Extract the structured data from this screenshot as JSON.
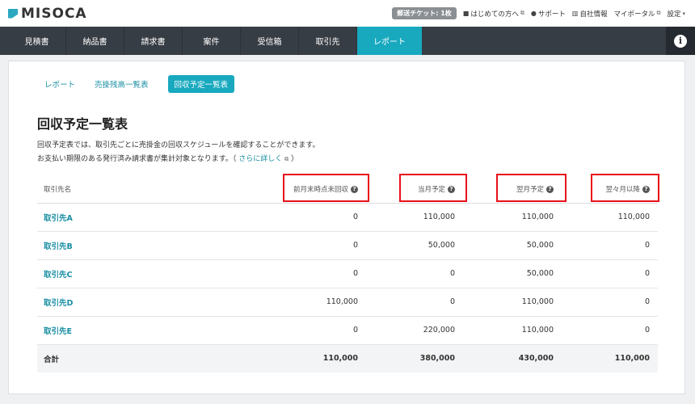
{
  "app": {
    "logo_text": "MISOCA"
  },
  "topbar": {
    "ticket": "郵送チケット: 1枚",
    "links": [
      {
        "label": "はじめての方へ",
        "icon": "book-icon"
      },
      {
        "label": "サポート",
        "icon": "question-icon"
      },
      {
        "label": "自社情報",
        "icon": "building-icon"
      },
      {
        "label": "マイポータル",
        "icon": ""
      }
    ],
    "settings": "設定"
  },
  "nav": {
    "items": [
      {
        "label": "見積書"
      },
      {
        "label": "納品書"
      },
      {
        "label": "請求書"
      },
      {
        "label": "案件"
      },
      {
        "label": "受信箱"
      },
      {
        "label": "取引先"
      },
      {
        "label": "レポート",
        "active": true
      }
    ],
    "info_glyph": "i"
  },
  "subtabs": [
    {
      "label": "レポート"
    },
    {
      "label": "売掛残高一覧表"
    },
    {
      "label": "回収予定一覧表",
      "active": true
    }
  ],
  "page": {
    "title": "回収予定一覧表",
    "desc_line1": "回収予定表では、取引先ごとに売掛金の回収スケジュールを確認することができます。",
    "desc_line2": "お支払い期限のある発行済み請求書が集計対象となります。（",
    "more_link": "さらに詳しく",
    "desc_close": "）"
  },
  "table": {
    "headers": [
      "取引先名",
      "前月末時点未回収",
      "当月予定",
      "翌月予定",
      "翌々月以降"
    ],
    "rows": [
      {
        "name": "取引先A",
        "values": [
          "0",
          "110,000",
          "110,000",
          "110,000"
        ]
      },
      {
        "name": "取引先B",
        "values": [
          "0",
          "50,000",
          "50,000",
          "0"
        ]
      },
      {
        "name": "取引先C",
        "values": [
          "0",
          "0",
          "50,000",
          "0"
        ]
      },
      {
        "name": "取引先D",
        "values": [
          "110,000",
          "0",
          "110,000",
          "0"
        ]
      },
      {
        "name": "取引先E",
        "values": [
          "0",
          "220,000",
          "110,000",
          "0"
        ]
      }
    ],
    "total": {
      "name": "合計",
      "values": [
        "110,000",
        "380,000",
        "430,000",
        "110,000"
      ]
    }
  },
  "colors": {
    "accent": "#18a9bf",
    "nav_bg": "#373d44",
    "highlight": "#e8101a"
  }
}
